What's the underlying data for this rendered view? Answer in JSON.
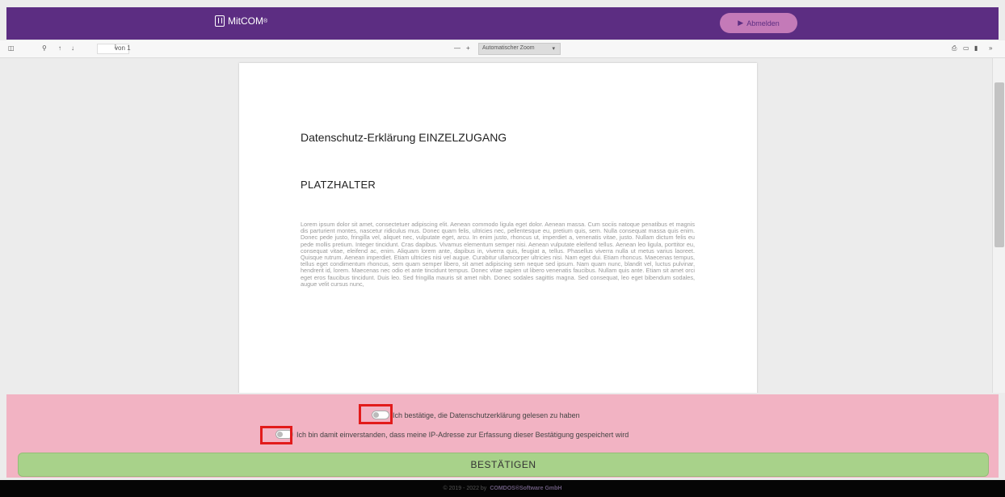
{
  "header": {
    "logo_text": "MitCOM",
    "logo_mark": "®",
    "logout_label": "Abmelden",
    "brand_color": "#5c2d82"
  },
  "pdf_toolbar": {
    "page_number": "1",
    "page_total": "von 1",
    "zoom_out": "—",
    "zoom_in": "+",
    "zoom_value": "Automatischer Zoom",
    "icons": [
      "sidebar-icon",
      "search-icon",
      "prev-page-icon",
      "next-page-icon",
      "print-icon",
      "open-file-icon",
      "bookmark-icon",
      "tools-icon"
    ]
  },
  "document": {
    "title": "Datenschutz-Erklärung EINZELZUGANG",
    "heading": "PLATZHALTER",
    "body": "Lorem ipsum dolor sit amet, consectetuer adipiscing elit. Aenean commodo ligula eget dolor. Aenean massa. Cum sociis natoque penatibus et magnis dis parturient montes, nascetur ridiculus mus. Donec quam felis, ultricies nec, pellentesque eu, pretium quis, sem. Nulla consequat massa quis enim. Donec pede justo, fringilla vel, aliquet nec, vulputate eget, arcu. In enim justo, rhoncus ut, imperdiet a, venenatis vitae, justo. Nullam dictum felis eu pede mollis pretium. Integer tincidunt. Cras dapibus. Vivamus elementum semper nisi. Aenean vulputate eleifend tellus. Aenean leo ligula, porttitor eu, consequat vitae, eleifend ac, enim. Aliquam lorem ante, dapibus in, viverra quis, feugiat a, tellus. Phasellus viverra nulla ut metus varius laoreet. Quisque rutrum. Aenean imperdiet. Etiam ultricies nisi vel augue. Curabitur ullamcorper ultricies nisi. Nam eget dui. Etiam rhoncus. Maecenas tempus, tellus eget condimentum rhoncus, sem quam semper libero, sit amet adipiscing sem neque sed ipsum. Nam quam nunc, blandit vel, luctus pulvinar, hendrerit id, lorem. Maecenas nec odio et ante tincidunt tempus. Donec vitae sapien ut libero venenatis faucibus. Nullam quis ante. Etiam sit amet orci eget eros faucibus tincidunt. Duis leo. Sed fringilla mauris sit amet nibh. Donec sodales sagittis magna. Sed consequat, leo eget bibendum sodales, augue velit cursus nunc,"
  },
  "consent": {
    "confirm_read": "Ich bestätige, die Datenschutzerklärung gelesen zu haben",
    "consent_ip": "Ich bin damit einverstanden, dass meine IP-Adresse zur Erfassung dieser Bestätigung gespeichert wird",
    "confirm_button": "BESTÄTIGEN",
    "panel_color": "#f2b3c3",
    "button_color": "#a8d28a",
    "highlight_color": "#e21b1b"
  },
  "footer": {
    "copyright": "© 2019 - 2022 by",
    "company": "COMDOS®Software GmbH"
  }
}
